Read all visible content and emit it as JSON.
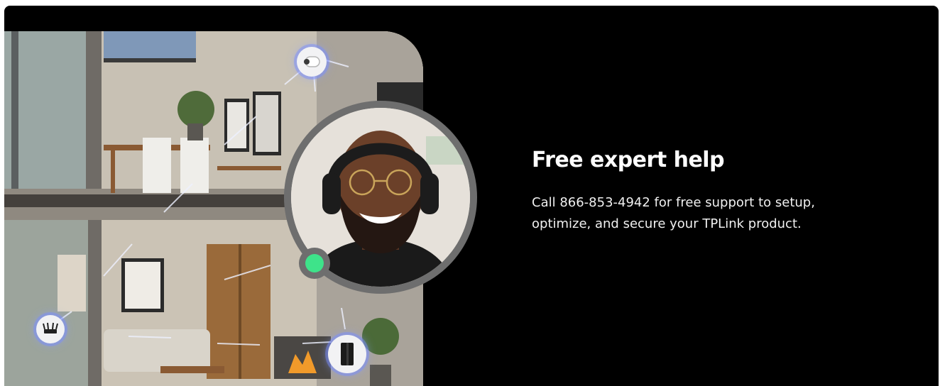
{
  "promo": {
    "title": "Free expert help",
    "description_line1": "Call 866-853-4942 for free support to setup,",
    "description_line2": "optimize, and secure your TPLink product."
  },
  "icons": {
    "camera": "security-camera-icon",
    "router": "router-icon",
    "mesh": "mesh-node-icon",
    "status": "online-status-icon"
  },
  "colors": {
    "background": "#000000",
    "text": "#ffffff",
    "online": "#3ee38a",
    "ring": "#6e6e6e",
    "device_glow": "#8ca0ff"
  }
}
